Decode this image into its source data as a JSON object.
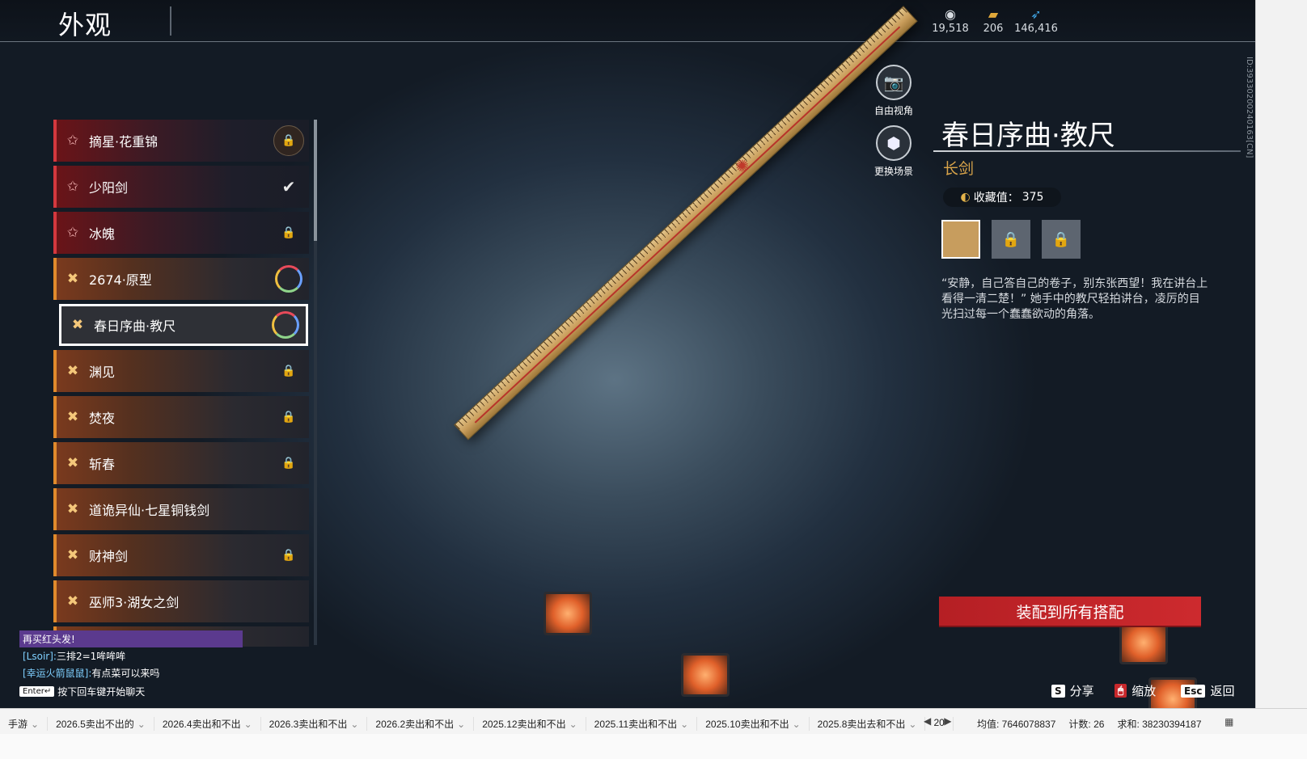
{
  "header": {
    "title": "外观"
  },
  "currencies": [
    {
      "icon": "coin-pile-icon",
      "value": "19,518"
    },
    {
      "icon": "gold-ingot-icon",
      "value": "206"
    },
    {
      "icon": "feather-icon",
      "value": "146,416"
    }
  ],
  "skins": [
    {
      "name": "摘星·花重锦",
      "tier": "red",
      "status": "locked-badge"
    },
    {
      "name": "少阳剑",
      "tier": "red",
      "status": "check"
    },
    {
      "name": "冰魄",
      "tier": "red",
      "status": "locked"
    },
    {
      "name": "2674·原型",
      "tier": "orange",
      "status": "ring"
    },
    {
      "name": "春日序曲·教尺",
      "tier": "orange",
      "status": "ring",
      "selected": true
    },
    {
      "name": "渊见",
      "tier": "orange",
      "status": "locked"
    },
    {
      "name": "焚夜",
      "tier": "orange",
      "status": "locked"
    },
    {
      "name": "斩春",
      "tier": "orange",
      "status": "locked"
    },
    {
      "name": "道诡异仙·七星铜钱剑",
      "tier": "orange",
      "status": "none"
    },
    {
      "name": "财神剑",
      "tier": "orange",
      "status": "locked"
    },
    {
      "name": "巫师3·湖女之剑",
      "tier": "orange",
      "status": "none"
    }
  ],
  "camera": {
    "free_view": "自由视角",
    "change_scene": "更换场景"
  },
  "detail": {
    "title": "春日序曲·教尺",
    "type": "长剑",
    "collection_label": "收藏值：",
    "collection_value": "375",
    "description": "“安静，自己答自己的卷子，别东张西望！我在讲台上看得一清二楚！” 她手中的教尺轻拍讲台，凌厉的目光扫过每一个蠢蠢欲动的角落。",
    "equip_button": "装配到所有搭配",
    "side_id": "ID:39330200240163[CN]"
  },
  "hints": [
    {
      "key": "S",
      "label": "分享"
    },
    {
      "key": "🖱",
      "label": "缩放"
    },
    {
      "key": "Esc",
      "label": "返回"
    }
  ],
  "chat": {
    "highlight": "再买红头发!",
    "messages": [
      {
        "name": "[Lsoir]:",
        "text": "三排2=1哞哞哞"
      },
      {
        "name": "[幸运火箭鼠鼠]:",
        "text": "有点菜可以来吗"
      }
    ],
    "enter_key": "Enter↵",
    "enter_hint": "按下回车键开始聊天"
  },
  "taskbar": {
    "tabs": [
      "手游",
      "2026.5卖出不出的",
      "2026.4卖出和不出",
      "2026.3卖出和不出",
      "2026.2卖出和不出",
      "2025.12卖出和不出",
      "2025.11卖出和不出",
      "2025.10卖出和不出",
      "2025.8卖出去和不出",
      "20"
    ],
    "average": "均值: 7646078837",
    "count": "计数: 26",
    "sum": "求和: 38230394187"
  },
  "colors": {
    "accent_red": "#c8282c",
    "gold": "#d9a44a",
    "tier_red": "#d4383e",
    "tier_orange": "#e08a2c"
  }
}
